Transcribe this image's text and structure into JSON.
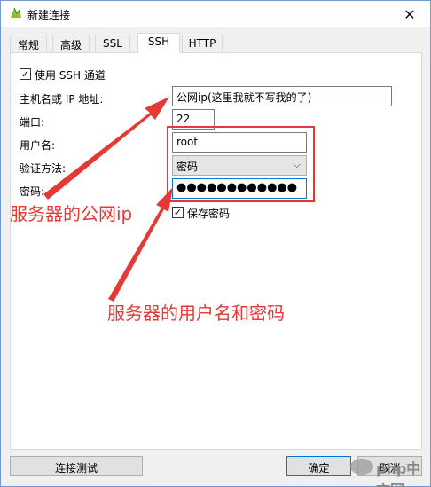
{
  "window": {
    "title": "新建连接"
  },
  "tabs": [
    {
      "label": "常规"
    },
    {
      "label": "高级"
    },
    {
      "label": "SSL"
    },
    {
      "label": "SSH",
      "active": true
    },
    {
      "label": "HTTP"
    }
  ],
  "ssh": {
    "use_ssh_label": "使用 SSH 通道",
    "use_ssh_checked": true,
    "host_label": "主机名或 IP 地址:",
    "host_value": "公网ip(这里我就不写我的了)",
    "port_label": "端口:",
    "port_value": "22",
    "user_label": "用户名:",
    "user_value": "root",
    "auth_label": "验证方法:",
    "auth_value": "密码",
    "password_label": "密码:",
    "password_value": "●●●●●●●●●●●●",
    "save_password_label": "保存密码",
    "save_password_checked": true
  },
  "annotations": {
    "server_ip": "服务器的公网ip",
    "user_pass": "服务器的用户名和密码"
  },
  "buttons": {
    "test": "连接测试",
    "ok": "确定",
    "cancel": "取消"
  },
  "watermark": {
    "text": "php中文网"
  },
  "colors": {
    "annotation": "#e53935",
    "focus": "#0078d7"
  }
}
